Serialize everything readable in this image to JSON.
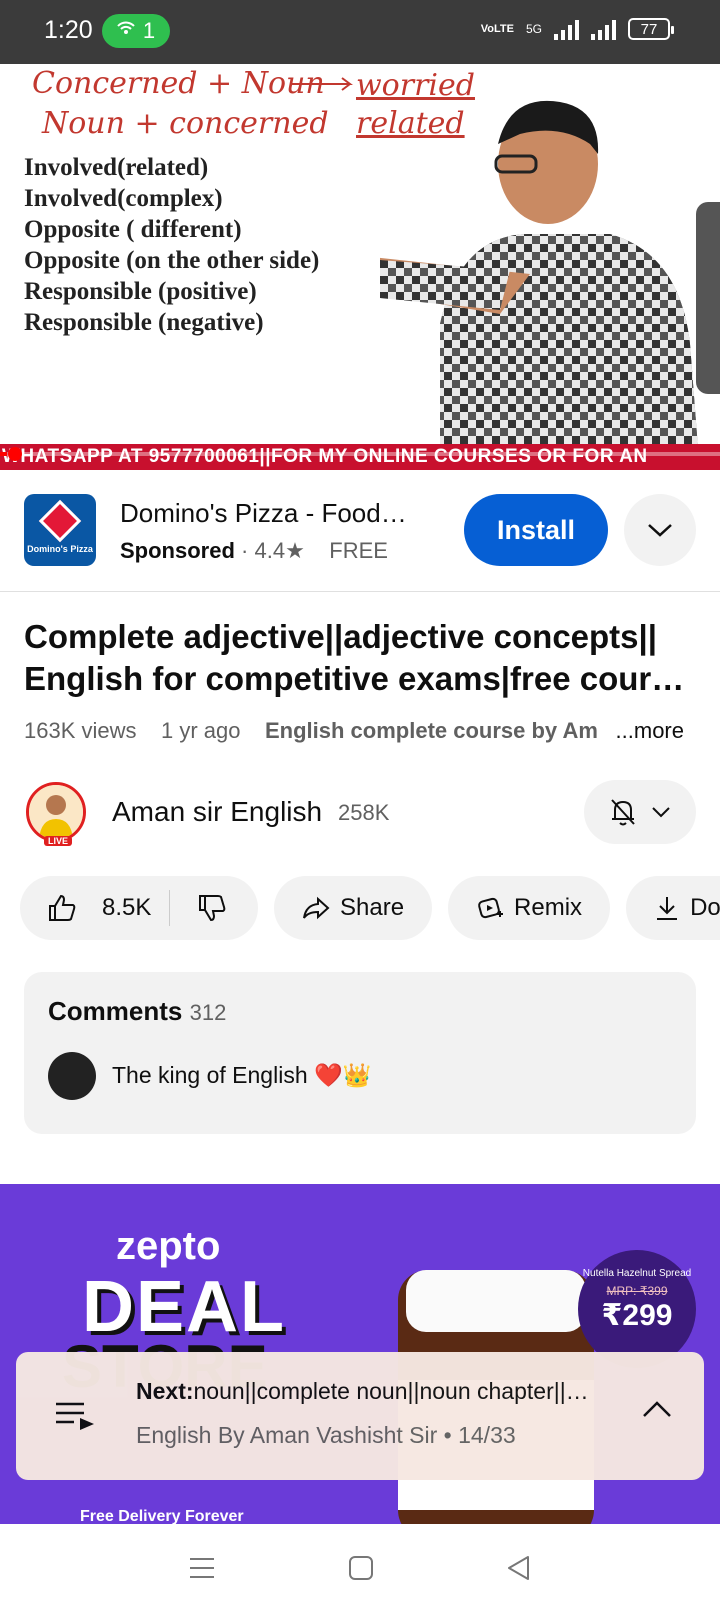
{
  "status_bar": {
    "time": "1:20",
    "hotspot_count": "1",
    "network": "5G",
    "volte": "VoLTE",
    "battery": "77"
  },
  "video": {
    "board_lines": [
      "Involved(related)",
      "Involved(complex)",
      "Opposite ( different)",
      "Opposite (on the other side)",
      "Responsible (positive)",
      "Responsible (negative)"
    ],
    "handwriting": [
      "Concerned + Noun",
      "Noun + concerned",
      "worried",
      "related"
    ],
    "ticker": "WHATSAPP AT 9577700061||FOR MY ONLINE COURSES OR FOR AN",
    "progress": 0.01
  },
  "ad": {
    "brand_logo_text": "Domino's Pizza",
    "title": "Domino's Pizza - Food…",
    "sponsored": "Sponsored",
    "rating": "4.4★",
    "price": "FREE",
    "install_label": "Install"
  },
  "video_info": {
    "title": "Complete adjective||adjective concepts|| English for competitive exams|free cour…",
    "views": "163K views",
    "age": "1 yr ago",
    "tag": "English complete course by Am",
    "more": "...more"
  },
  "channel": {
    "name": "Aman sir English",
    "subscribers": "258K",
    "live_badge": "LIVE"
  },
  "actions": {
    "likes": "8.5K",
    "share": "Share",
    "remix": "Remix",
    "download": "Dow"
  },
  "comments": {
    "label": "Comments",
    "count": "312",
    "top_comment": "The king of English ❤️👑"
  },
  "banner": {
    "brand": "zepto",
    "headline1": "DEAL",
    "headline2": "STORE",
    "product_name": "Nutella Hazelnut Spread",
    "mrp": "MRP: ₹399",
    "price": "₹299",
    "footer": "Free Delivery Forever"
  },
  "next_up": {
    "prefix": "Next:",
    "title": "noun||complete noun||noun chapter||…",
    "subtitle": "English By Aman Vashisht Sir • 14/33"
  },
  "colors": {
    "install": "#065fd4",
    "ticker": "#c8102e",
    "banner": "#6a3bd8",
    "hotspot": "#2fbf4f"
  }
}
